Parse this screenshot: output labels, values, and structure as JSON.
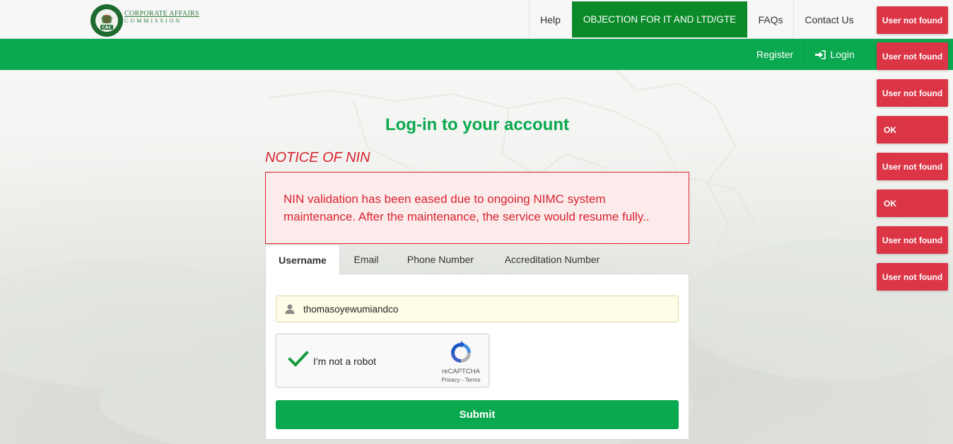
{
  "brand": {
    "logo_name": "cac-logo",
    "logo_line1": "CORPORATE AFFAIRS",
    "logo_line2": "COMMISSION",
    "seal_text": "CAC"
  },
  "topnav": {
    "help": "Help",
    "objection": "OBJECTION FOR IT AND LTD/GTE",
    "faqs": "FAQs",
    "contact": "Contact Us"
  },
  "subnav": {
    "register": "Register",
    "login": "Login",
    "login_icon": "sign-in-icon"
  },
  "toasts": [
    "User not found",
    "User not found",
    "User not found",
    "OK",
    "User not found",
    "OK",
    "User not found",
    "User not found"
  ],
  "page": {
    "title": "Log-in to your account",
    "notice_title": "NOTICE OF NIN",
    "notice_text": "NIN validation has been eased due to ongoing NIMC system maintenance. After the maintenance, the service would resume fully.."
  },
  "tabs": [
    "Username",
    "Email",
    "Phone Number",
    "Accreditation Number"
  ],
  "form": {
    "username_value": "thomasoyewumiandco",
    "user_icon": "user-icon"
  },
  "captcha": {
    "label": "I'm not a robot",
    "brand": "reCAPTCHA",
    "links": "Privacy - Terms",
    "checked": true
  },
  "submit_label": "Submit",
  "colors": {
    "green": "#0aa84f",
    "dark_green": "#0b8a2a",
    "alert_red": "#d9232f",
    "toast_red": "#dc3545"
  }
}
